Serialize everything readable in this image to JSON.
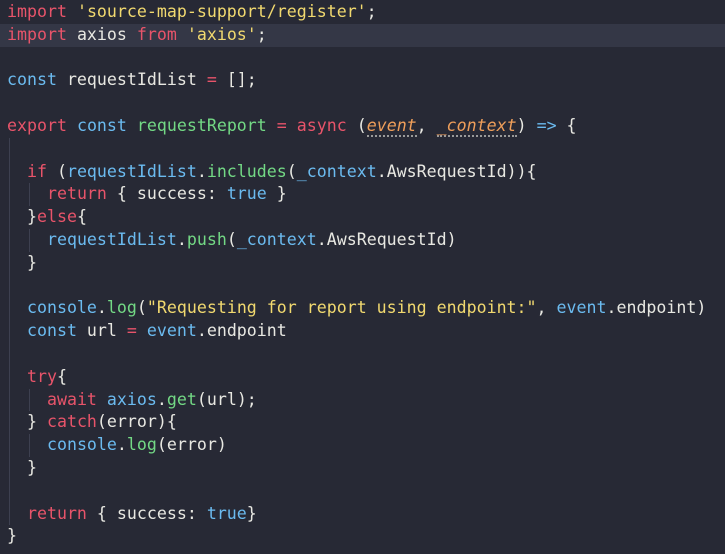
{
  "editor": {
    "lines": [
      {
        "tokens": [
          {
            "t": "import",
            "c": "kw"
          },
          {
            "t": " ",
            "c": "plain"
          },
          {
            "t": "'source-map-support/register'",
            "c": "str"
          },
          {
            "t": ";",
            "c": "plain"
          }
        ]
      },
      {
        "highlight": true,
        "tokens": [
          {
            "t": "import",
            "c": "kw"
          },
          {
            "t": " axios ",
            "c": "plain"
          },
          {
            "t": "from",
            "c": "kw"
          },
          {
            "t": " ",
            "c": "plain"
          },
          {
            "t": "'axios'",
            "c": "str"
          },
          {
            "t": ";",
            "c": "plain"
          }
        ]
      },
      {
        "tokens": []
      },
      {
        "tokens": [
          {
            "t": "const",
            "c": "var"
          },
          {
            "t": " requestIdList ",
            "c": "plain"
          },
          {
            "t": "=",
            "c": "op"
          },
          {
            "t": " [];",
            "c": "plain"
          }
        ]
      },
      {
        "tokens": []
      },
      {
        "tokens": [
          {
            "t": "export",
            "c": "kw"
          },
          {
            "t": " ",
            "c": "plain"
          },
          {
            "t": "const",
            "c": "var"
          },
          {
            "t": " ",
            "c": "plain"
          },
          {
            "t": "requestReport",
            "c": "fn"
          },
          {
            "t": " ",
            "c": "plain"
          },
          {
            "t": "=",
            "c": "op"
          },
          {
            "t": " ",
            "c": "plain"
          },
          {
            "t": "async",
            "c": "kw"
          },
          {
            "t": " (",
            "c": "plain"
          },
          {
            "t": "event",
            "c": "par",
            "u": true
          },
          {
            "t": ", ",
            "c": "plain"
          },
          {
            "t": "_context",
            "c": "par",
            "u": true
          },
          {
            "t": ") ",
            "c": "plain"
          },
          {
            "t": "=>",
            "c": "var"
          },
          {
            "t": " {",
            "c": "plain"
          }
        ]
      },
      {
        "guides": 1,
        "tokens": []
      },
      {
        "guides": 1,
        "tokens": [
          {
            "t": "  ",
            "c": "plain"
          },
          {
            "t": "if",
            "c": "kw"
          },
          {
            "t": " (",
            "c": "plain"
          },
          {
            "t": "requestIdList",
            "c": "var"
          },
          {
            "t": ".",
            "c": "plain"
          },
          {
            "t": "includes",
            "c": "fn"
          },
          {
            "t": "(",
            "c": "plain"
          },
          {
            "t": "_context",
            "c": "var"
          },
          {
            "t": ".AwsRequestId)){",
            "c": "plain"
          }
        ]
      },
      {
        "guides": 2,
        "tokens": [
          {
            "t": "    ",
            "c": "plain"
          },
          {
            "t": "return",
            "c": "kw"
          },
          {
            "t": " { success: ",
            "c": "plain"
          },
          {
            "t": "true",
            "c": "bool"
          },
          {
            "t": " }",
            "c": "plain"
          }
        ]
      },
      {
        "guides": 1,
        "tokens": [
          {
            "t": "  }",
            "c": "plain"
          },
          {
            "t": "else",
            "c": "kw"
          },
          {
            "t": "{",
            "c": "plain"
          }
        ]
      },
      {
        "guides": 2,
        "tokens": [
          {
            "t": "    ",
            "c": "plain"
          },
          {
            "t": "requestIdList",
            "c": "var"
          },
          {
            "t": ".",
            "c": "plain"
          },
          {
            "t": "push",
            "c": "fn"
          },
          {
            "t": "(",
            "c": "plain"
          },
          {
            "t": "_context",
            "c": "var"
          },
          {
            "t": ".AwsRequestId)",
            "c": "plain"
          }
        ]
      },
      {
        "guides": 1,
        "tokens": [
          {
            "t": "  }",
            "c": "plain"
          }
        ]
      },
      {
        "guides": 1,
        "tokens": []
      },
      {
        "guides": 1,
        "tokens": [
          {
            "t": "  ",
            "c": "plain"
          },
          {
            "t": "console",
            "c": "var"
          },
          {
            "t": ".",
            "c": "plain"
          },
          {
            "t": "log",
            "c": "fn"
          },
          {
            "t": "(",
            "c": "plain"
          },
          {
            "t": "\"Requesting for report using endpoint:\"",
            "c": "str"
          },
          {
            "t": ", ",
            "c": "plain"
          },
          {
            "t": "event",
            "c": "var"
          },
          {
            "t": ".endpoint)",
            "c": "plain"
          }
        ]
      },
      {
        "guides": 1,
        "tokens": [
          {
            "t": "  ",
            "c": "plain"
          },
          {
            "t": "const",
            "c": "var"
          },
          {
            "t": " url ",
            "c": "plain"
          },
          {
            "t": "=",
            "c": "op"
          },
          {
            "t": " ",
            "c": "plain"
          },
          {
            "t": "event",
            "c": "var"
          },
          {
            "t": ".endpoint",
            "c": "plain"
          }
        ]
      },
      {
        "guides": 1,
        "tokens": []
      },
      {
        "guides": 1,
        "tokens": [
          {
            "t": "  ",
            "c": "plain"
          },
          {
            "t": "try",
            "c": "kw"
          },
          {
            "t": "{",
            "c": "plain"
          }
        ]
      },
      {
        "guides": 2,
        "tokens": [
          {
            "t": "    ",
            "c": "plain"
          },
          {
            "t": "await",
            "c": "kw"
          },
          {
            "t": " ",
            "c": "plain"
          },
          {
            "t": "axios",
            "c": "var"
          },
          {
            "t": ".",
            "c": "plain"
          },
          {
            "t": "get",
            "c": "fn"
          },
          {
            "t": "(url);",
            "c": "plain"
          }
        ]
      },
      {
        "guides": 1,
        "tokens": [
          {
            "t": "  } ",
            "c": "plain"
          },
          {
            "t": "catch",
            "c": "kw"
          },
          {
            "t": "(error){",
            "c": "plain"
          }
        ]
      },
      {
        "guides": 2,
        "tokens": [
          {
            "t": "    ",
            "c": "plain"
          },
          {
            "t": "console",
            "c": "var"
          },
          {
            "t": ".",
            "c": "plain"
          },
          {
            "t": "log",
            "c": "fn"
          },
          {
            "t": "(error)",
            "c": "plain"
          }
        ]
      },
      {
        "guides": 1,
        "tokens": [
          {
            "t": "  }",
            "c": "plain"
          }
        ]
      },
      {
        "guides": 1,
        "tokens": []
      },
      {
        "guides": 1,
        "tokens": [
          {
            "t": "  ",
            "c": "plain"
          },
          {
            "t": "return",
            "c": "kw"
          },
          {
            "t": " { success: ",
            "c": "plain"
          },
          {
            "t": "true",
            "c": "bool"
          },
          {
            "t": "}",
            "c": "plain"
          }
        ]
      },
      {
        "tokens": [
          {
            "t": "}",
            "c": "plain"
          }
        ]
      }
    ]
  }
}
